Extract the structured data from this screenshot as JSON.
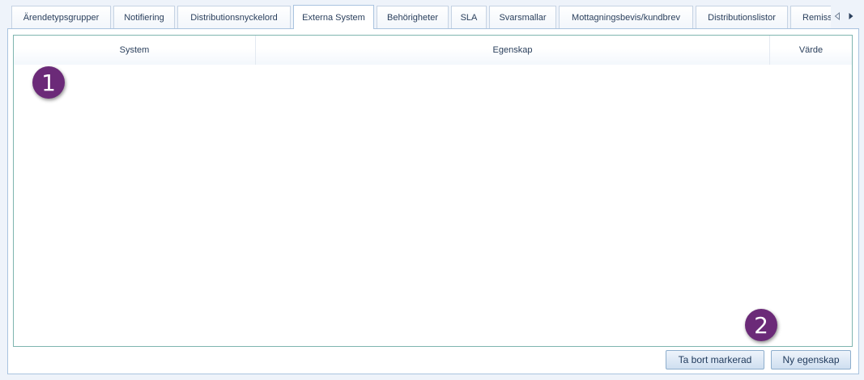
{
  "tabs": [
    {
      "label": "Ärendetypsgrupper",
      "active": false
    },
    {
      "label": "Notifiering",
      "active": false
    },
    {
      "label": "Distributionsnyckelord",
      "active": false
    },
    {
      "label": "Externa System",
      "active": true
    },
    {
      "label": "Behörigheter",
      "active": false
    },
    {
      "label": "SLA",
      "active": false
    },
    {
      "label": "Svarsmallar",
      "active": false
    },
    {
      "label": "Mottagningsbevis/kundbrev",
      "active": false
    },
    {
      "label": "Distributionslistor",
      "active": false
    },
    {
      "label": "Remiss",
      "active": false
    }
  ],
  "tab_nav": {
    "prev_icon": "triangle-left-icon",
    "next_icon": "triangle-right-icon"
  },
  "grid": {
    "columns": [
      "System",
      "Egenskap",
      "Värde"
    ],
    "rows": []
  },
  "buttons": {
    "delete_label": "Ta bort markerad",
    "new_label": "Ny egenskap"
  },
  "markers": {
    "first": "1",
    "second": "2"
  },
  "colors": {
    "accent": "#a9c3df",
    "grid_border": "#7fb5b0",
    "marker": "#6b2a78",
    "background": "#eef3fa"
  }
}
